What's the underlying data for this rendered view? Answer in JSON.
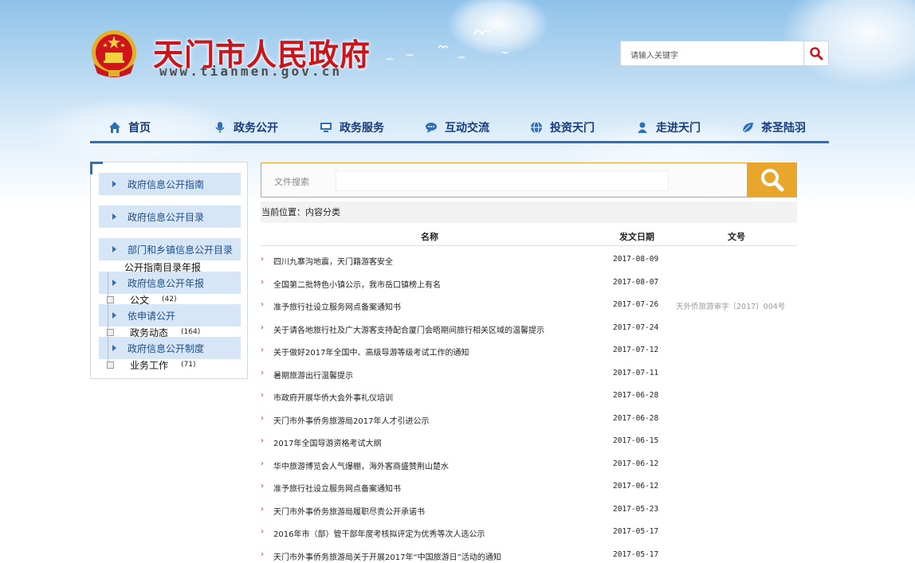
{
  "header": {
    "site_title": "天门市人民政府",
    "site_domain": "www.tianmen.gov.cn",
    "search_placeholder": "请输入关键字"
  },
  "nav": [
    {
      "label": "首页",
      "icon": "home-icon"
    },
    {
      "label": "政务公开",
      "icon": "microphone-icon"
    },
    {
      "label": "政务服务",
      "icon": "monitor-icon"
    },
    {
      "label": "互动交流",
      "icon": "chat-icon"
    },
    {
      "label": "投资天门",
      "icon": "globe-icon"
    },
    {
      "label": "走进天门",
      "icon": "person-icon"
    },
    {
      "label": "茶圣陆羽",
      "icon": "leaf-icon"
    }
  ],
  "sidebar": {
    "items": [
      {
        "label": "政府信息公开指南"
      },
      {
        "label": "政府信息公开目录"
      },
      {
        "label": "部门和乡镇信息公开目录"
      },
      {
        "label": "政府信息公开年报"
      },
      {
        "label": "依申请公开"
      },
      {
        "label": "政府信息公开制度"
      }
    ],
    "tree": [
      {
        "label": "公开指南目录年报",
        "count": ""
      },
      {
        "label": "公文",
        "count": "(42)"
      },
      {
        "label": "政务动态",
        "count": "(164)"
      },
      {
        "label": "业务工作",
        "count": "(71)"
      }
    ]
  },
  "doc_search": {
    "label": "文件搜索"
  },
  "breadcrumb": "当前位置：内容分类",
  "table": {
    "headers": [
      "名称",
      "发文日期",
      "文号"
    ],
    "rows": [
      {
        "title": "四川九寨沟地震，天门籍游客安全",
        "date": "2017-08-09",
        "doc": ""
      },
      {
        "title": "全国第二批特色小镇公示，我市岳口镇榜上有名",
        "date": "2017-08-07",
        "doc": ""
      },
      {
        "title": "准予旅行社设立服务网点备案通知书",
        "date": "2017-07-26",
        "doc": "天外侨旅游审字〔2017〕004号"
      },
      {
        "title": "关于请各地旅行社及广大游客支持配合厦门会晤期间旅行相关区域的温馨提示",
        "date": "2017-07-24",
        "doc": ""
      },
      {
        "title": "关于做好2017年全国中、高级导游等级考试工作的通知",
        "date": "2017-07-12",
        "doc": ""
      },
      {
        "title": "暑期旅游出行温馨提示",
        "date": "2017-07-11",
        "doc": ""
      },
      {
        "title": "市政府开展华侨大会外事礼仪培训",
        "date": "2017-06-28",
        "doc": ""
      },
      {
        "title": "天门市外事侨务旅游局2017年人才引进公示",
        "date": "2017-06-28",
        "doc": ""
      },
      {
        "title": "2017年全国导游资格考试大纲",
        "date": "2017-06-15",
        "doc": ""
      },
      {
        "title": "华中旅游博览会人气爆棚，海外客商盛赞荆山楚水",
        "date": "2017-06-12",
        "doc": ""
      },
      {
        "title": "准予旅行社设立服务网点备案通知书",
        "date": "2017-06-12",
        "doc": ""
      },
      {
        "title": "天门市外事侨务旅游局履职尽责公开承诺书",
        "date": "2017-05-23",
        "doc": ""
      },
      {
        "title": "2016年市（部）管干部年度考核拟评定为优秀等次人选公示",
        "date": "2017-05-17",
        "doc": ""
      },
      {
        "title": "天门市外事侨务旅游局关于开展2017年“中国旅游日”活动的通知",
        "date": "2017-05-17",
        "doc": ""
      }
    ]
  },
  "colors": {
    "brand_red": "#c8161d",
    "nav_blue": "#163b7e",
    "accent_blue": "#2f6fb6",
    "search_orange": "#e8a62c"
  }
}
